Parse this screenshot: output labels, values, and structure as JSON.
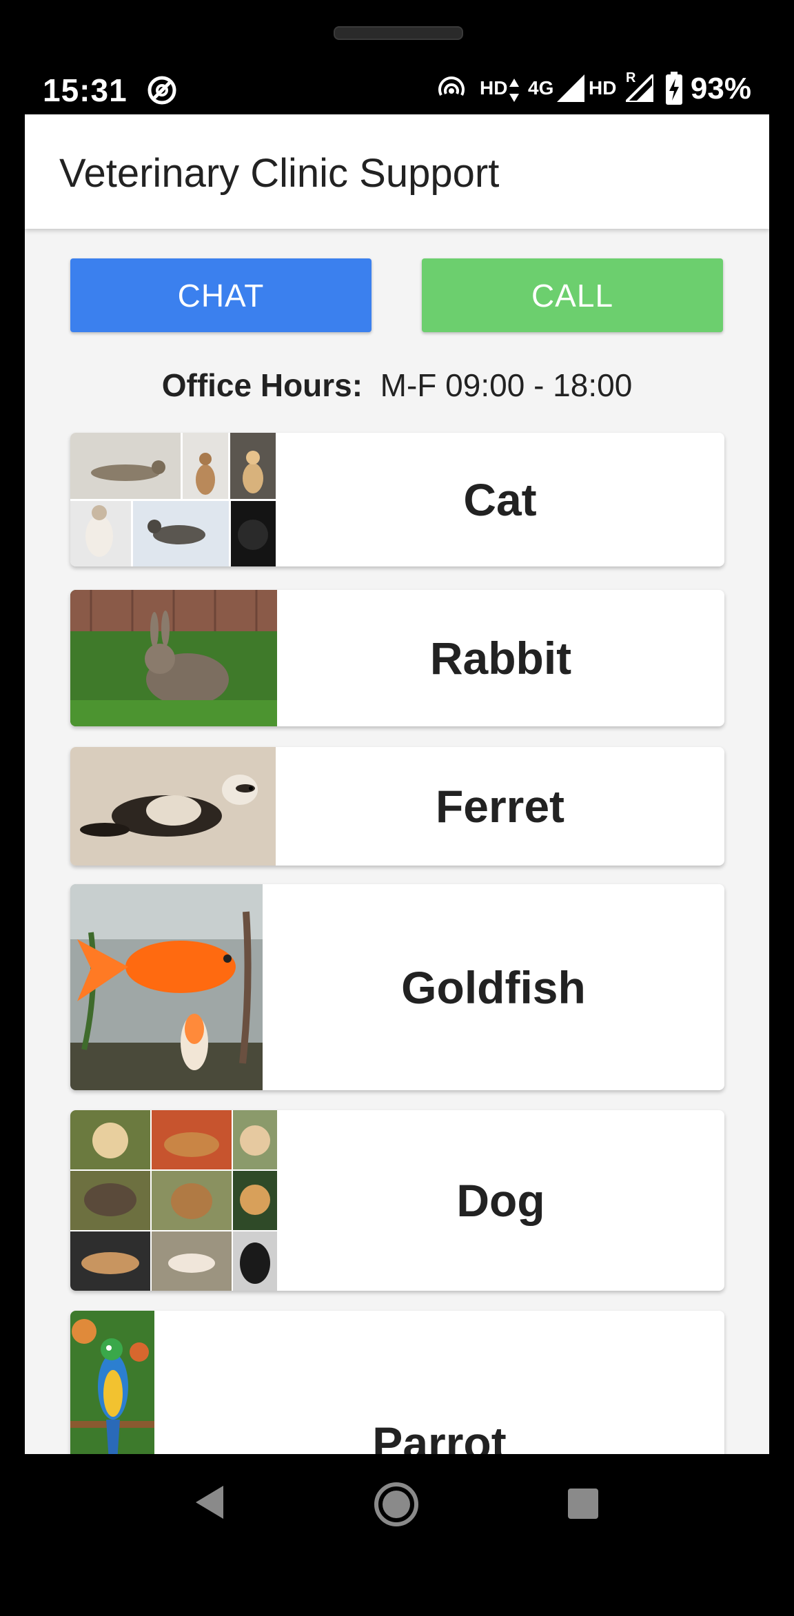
{
  "status_bar": {
    "time": "15:31",
    "hd1": "HD",
    "net": "4G",
    "hd2": "HD",
    "roaming": "R",
    "battery": "93%"
  },
  "app_bar": {
    "title": "Veterinary Clinic Support"
  },
  "actions": {
    "chat_label": "CHAT",
    "call_label": "CALL",
    "chat_color": "#3b80ee",
    "call_color": "#6ccf6e"
  },
  "office_hours": {
    "label": "Office Hours:",
    "value": "M-F 09:00 - 18:00"
  },
  "animals": [
    {
      "label": "Cat",
      "image": "cat-collage-photo"
    },
    {
      "label": "Rabbit",
      "image": "rabbit-photo"
    },
    {
      "label": "Ferret",
      "image": "ferret-photo"
    },
    {
      "label": "Goldfish",
      "image": "goldfish-photo"
    },
    {
      "label": "Dog",
      "image": "dog-collage-photo"
    },
    {
      "label": "Parrot",
      "image": "parrot-photo"
    }
  ],
  "nav_bar": {
    "icons": [
      "back-icon",
      "home-icon",
      "recents-icon"
    ]
  }
}
